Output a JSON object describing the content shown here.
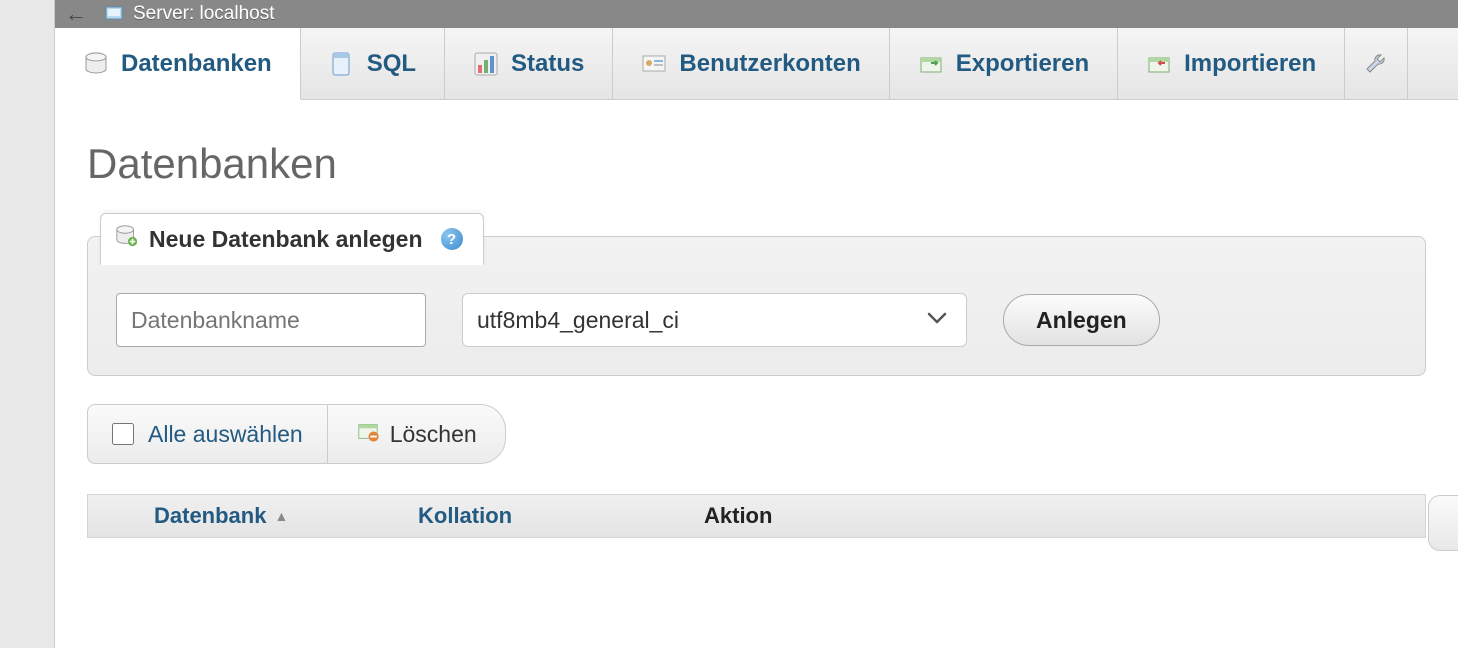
{
  "breadcrumb": {
    "server_label": "Server: localhost"
  },
  "tabs": [
    {
      "label": "Datenbanken"
    },
    {
      "label": "SQL"
    },
    {
      "label": "Status"
    },
    {
      "label": "Benutzerkonten"
    },
    {
      "label": "Exportieren"
    },
    {
      "label": "Importieren"
    }
  ],
  "page": {
    "title": "Datenbanken"
  },
  "create": {
    "legend": "Neue Datenbank anlegen",
    "name_placeholder": "Datenbankname",
    "collation_value": "utf8mb4_general_ci",
    "submit_label": "Anlegen"
  },
  "actions": {
    "select_all_label": "Alle auswählen",
    "delete_label": "Löschen"
  },
  "table": {
    "col_database": "Datenbank",
    "col_collation": "Kollation",
    "col_action": "Aktion"
  }
}
